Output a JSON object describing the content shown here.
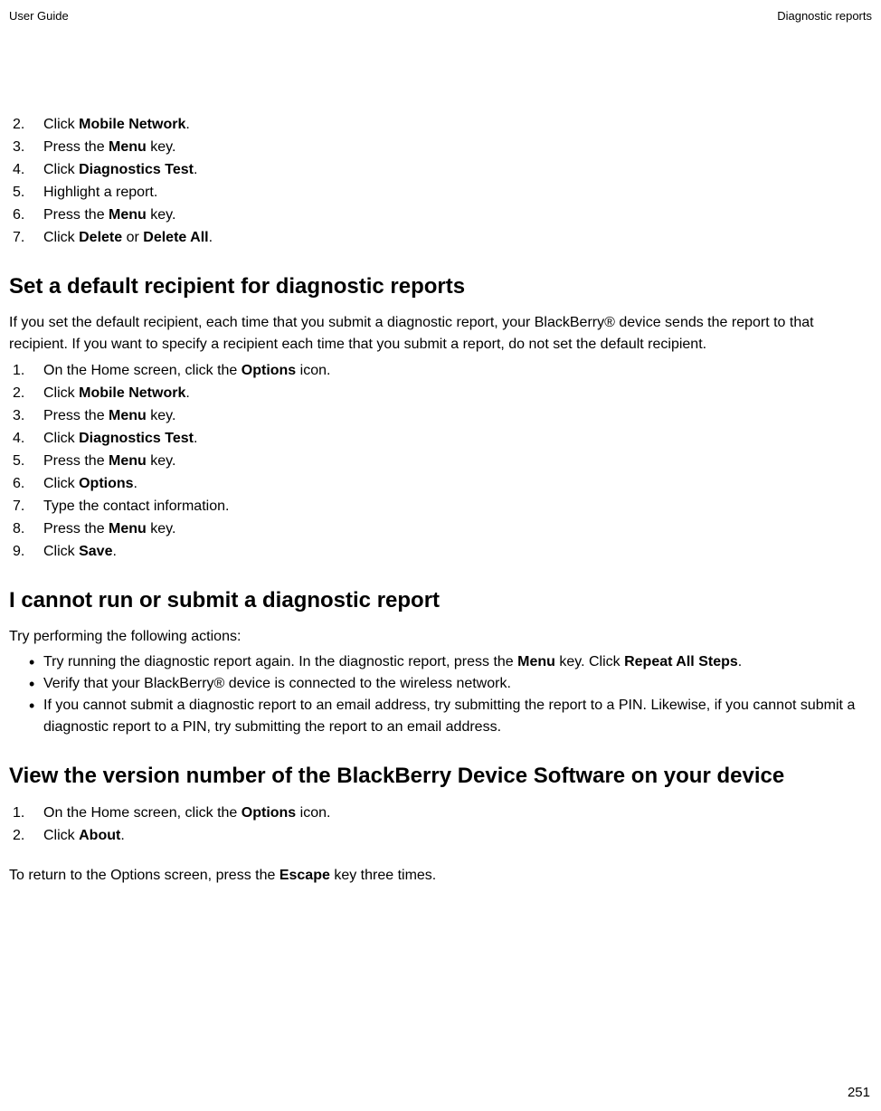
{
  "header": {
    "left": "User Guide",
    "right": "Diagnostic reports"
  },
  "section1": {
    "steps": [
      {
        "num": "2.",
        "pre": "Click ",
        "bold": "Mobile Network",
        "post": "."
      },
      {
        "num": "3.",
        "pre": "Press the ",
        "bold": "Menu",
        "post": " key."
      },
      {
        "num": "4.",
        "pre": "Click ",
        "bold": "Diagnostics Test",
        "post": "."
      },
      {
        "num": "5.",
        "pre": "",
        "bold": "",
        "post": "Highlight a report."
      },
      {
        "num": "6.",
        "pre": "Press the ",
        "bold": "Menu",
        "post": " key."
      },
      {
        "num": "7.",
        "pre": "Click ",
        "bold": "Delete",
        "post": " or ",
        "bold2": "Delete All",
        "post2": "."
      }
    ]
  },
  "section2": {
    "heading": "Set a default recipient for diagnostic reports",
    "intro": "If you set the default recipient, each time that you submit a diagnostic report, your BlackBerry® device sends the report to that recipient. If you want to specify a recipient each time that you submit a report, do not set the default recipient.",
    "steps": [
      {
        "num": "1.",
        "pre": "On the Home screen, click the ",
        "bold": "Options",
        "post": " icon."
      },
      {
        "num": "2.",
        "pre": "Click ",
        "bold": "Mobile Network",
        "post": "."
      },
      {
        "num": "3.",
        "pre": "Press the ",
        "bold": "Menu",
        "post": " key."
      },
      {
        "num": "4.",
        "pre": "Click ",
        "bold": "Diagnostics Test",
        "post": "."
      },
      {
        "num": "5.",
        "pre": "Press the ",
        "bold": "Menu",
        "post": " key."
      },
      {
        "num": "6.",
        "pre": "Click ",
        "bold": "Options",
        "post": "."
      },
      {
        "num": "7.",
        "pre": "",
        "bold": "",
        "post": "Type the contact information."
      },
      {
        "num": "8.",
        "pre": "Press the ",
        "bold": "Menu",
        "post": " key."
      },
      {
        "num": "9.",
        "pre": "Click ",
        "bold": "Save",
        "post": "."
      }
    ]
  },
  "section3": {
    "heading": "I cannot run or submit a diagnostic report",
    "intro": "Try performing the following actions:",
    "bullets": [
      {
        "pre": "Try running the diagnostic report again. In the diagnostic report, press the ",
        "bold": "Menu",
        "mid": " key. Click ",
        "bold2": "Repeat All Steps",
        "post": "."
      },
      {
        "pre": "",
        "bold": "",
        "mid": "",
        "bold2": "",
        "post": "Verify that your BlackBerry® device is connected to the wireless network."
      },
      {
        "pre": "",
        "bold": "",
        "mid": "",
        "bold2": "",
        "post": "If you cannot submit a diagnostic report to an email address, try submitting the report to a PIN. Likewise, if you cannot submit a diagnostic report to a PIN, try submitting the report to an email address."
      }
    ]
  },
  "section4": {
    "heading": "View the version number of the BlackBerry Device Software on your device",
    "steps": [
      {
        "num": "1.",
        "pre": "On the Home screen, click the ",
        "bold": "Options",
        "post": " icon."
      },
      {
        "num": "2.",
        "pre": "Click ",
        "bold": "About",
        "post": "."
      }
    ],
    "outro_pre": "To return to the Options screen, press the ",
    "outro_bold": "Escape",
    "outro_post": " key three times."
  },
  "pageNumber": "251"
}
